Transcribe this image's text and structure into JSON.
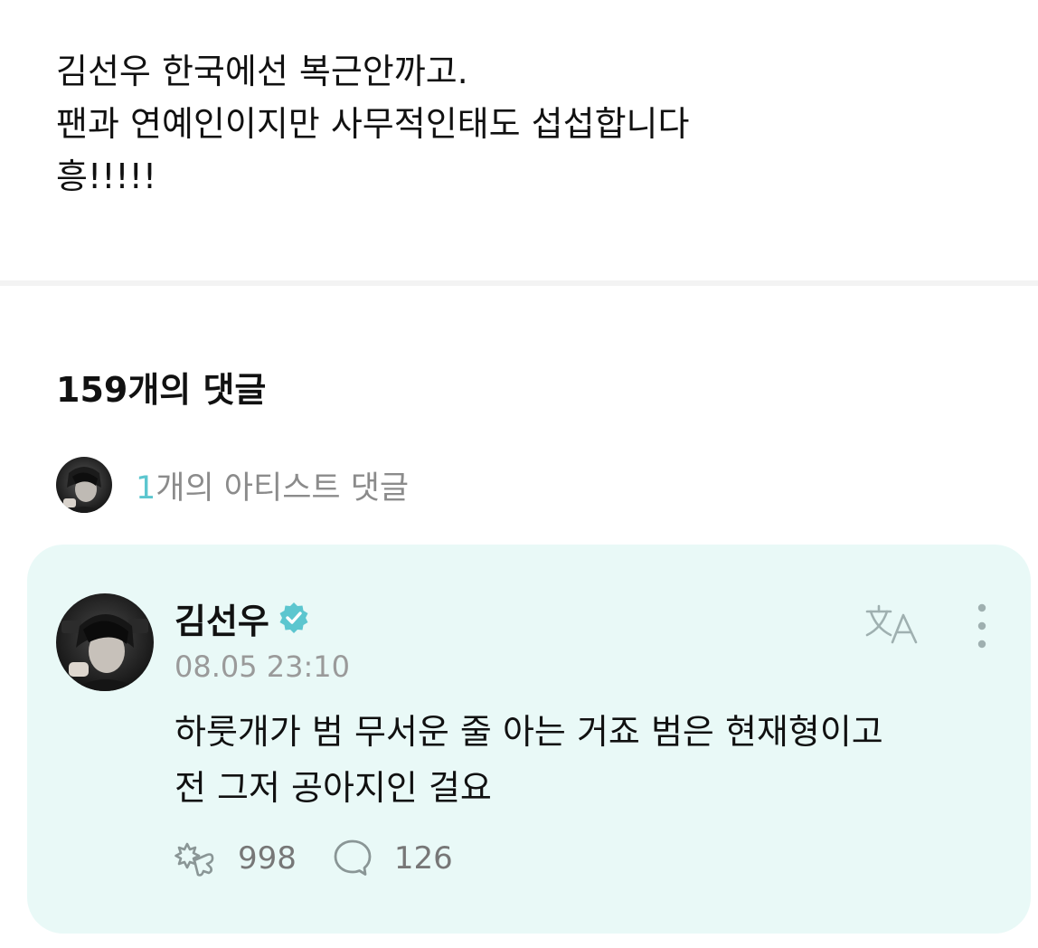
{
  "post": {
    "lines": [
      "김선우 한국에선 복근안까고.",
      "팬과 연예인이지만 사무적인태도 섭섭합니다",
      "흥!!!!!"
    ]
  },
  "comments": {
    "count_label": "159개의 댓글",
    "artist_summary": {
      "count": "1",
      "label": "개의 아티스트 댓글"
    }
  },
  "artist_comment": {
    "author": "김선우",
    "timestamp": "08.05 23:10",
    "lines": [
      " 하룻개가 범 무서운 줄 아는 거죠 범은 현재형이고",
      "전 그저 공아지인 걸요"
    ],
    "like_count": "998",
    "reply_count": "126"
  },
  "colors": {
    "accent": "#5cc6cf",
    "card_background": "#e9f9f7",
    "verified_badge": "#5cc6cf",
    "muted_text": "#8b8b8b"
  },
  "icons": {
    "verified": "verified-badge-icon",
    "translate": "translate-icon",
    "more": "more-vertical-icon",
    "like": "like-sparkle-icon",
    "reply": "reply-bubble-icon"
  }
}
